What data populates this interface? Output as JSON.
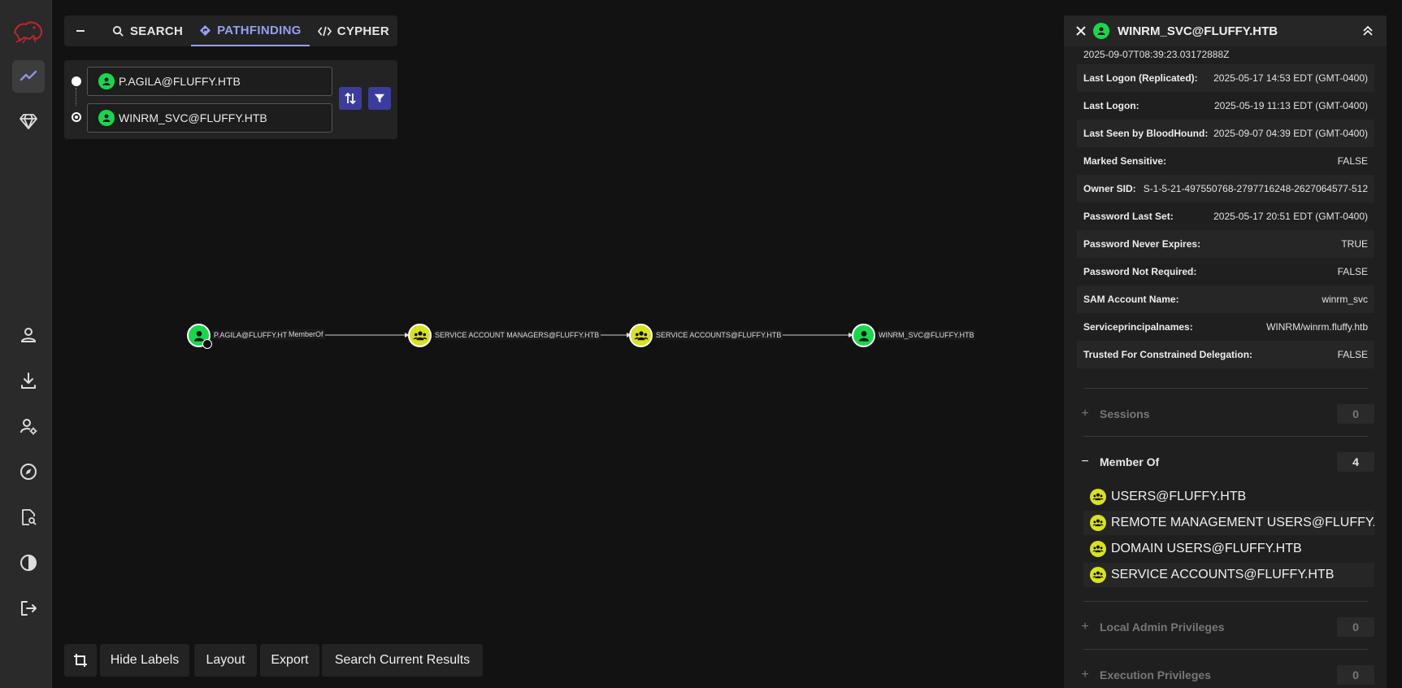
{
  "tabs": {
    "search": "SEARCH",
    "pathfinding": "PATHFINDING",
    "cypher": "CYPHER"
  },
  "pathfinding": {
    "source": "P.AGILA@FLUFFY.HTB",
    "target": "WINRM_SVC@FLUFFY.HTB"
  },
  "graph": {
    "nodes": [
      {
        "label": "P.AGILA@FLUFFY.HTB",
        "type": "user"
      },
      {
        "label": "SERVICE ACCOUNT MANAGERS@FLUFFY.HTB",
        "type": "group"
      },
      {
        "label": "SERVICE ACCOUNTS@FLUFFY.HTB",
        "type": "group"
      },
      {
        "label": "WINRM_SVC@FLUFFY.HTB",
        "type": "user"
      }
    ],
    "edge_label": "MemberOf"
  },
  "toolbar": {
    "hide_labels": "Hide Labels",
    "layout": "Layout",
    "export": "Export",
    "search_current": "Search Current Results"
  },
  "panel": {
    "title": "WINRM_SVC@FLUFFY.HTB",
    "top_value": "2025-09-07T08:39:23.03172888Z",
    "properties": [
      {
        "key": "Last Logon (Replicated):",
        "value": "2025-05-17 14:53 EDT (GMT-0400)"
      },
      {
        "key": "Last Logon:",
        "value": "2025-05-19 11:13 EDT (GMT-0400)"
      },
      {
        "key": "Last Seen by BloodHound:",
        "value": "2025-09-07 04:39 EDT (GMT-0400)"
      },
      {
        "key": "Marked Sensitive:",
        "value": "FALSE"
      },
      {
        "key": "Owner SID:",
        "value": "S-1-5-21-497550768-2797716248-2627064577-512"
      },
      {
        "key": "Password Last Set:",
        "value": "2025-05-17 20:51 EDT (GMT-0400)"
      },
      {
        "key": "Password Never Expires:",
        "value": "TRUE"
      },
      {
        "key": "Password Not Required:",
        "value": "FALSE"
      },
      {
        "key": "SAM Account Name:",
        "value": "winrm_svc"
      },
      {
        "key": "Serviceprincipalnames:",
        "value": "WINRM/winrm.fluffy.htb"
      },
      {
        "key": "Trusted For Constrained Delegation:",
        "value": "FALSE"
      }
    ],
    "sessions": {
      "label": "Sessions",
      "count": "0"
    },
    "member_of": {
      "label": "Member Of",
      "count": "4",
      "items": [
        "USERS@FLUFFY.HTB",
        "REMOTE MANAGEMENT USERS@FLUFFY....",
        "DOMAIN USERS@FLUFFY.HTB",
        "SERVICE ACCOUNTS@FLUFFY.HTB"
      ]
    },
    "local_admin": {
      "label": "Local Admin Privileges",
      "count": "0"
    },
    "execution": {
      "label": "Execution Privileges",
      "count": "0"
    }
  },
  "colors": {
    "user_node": "#17d84b",
    "group_node": "#d9e21c",
    "accent": "#9a9ef0",
    "button": "#3b3d9c"
  }
}
